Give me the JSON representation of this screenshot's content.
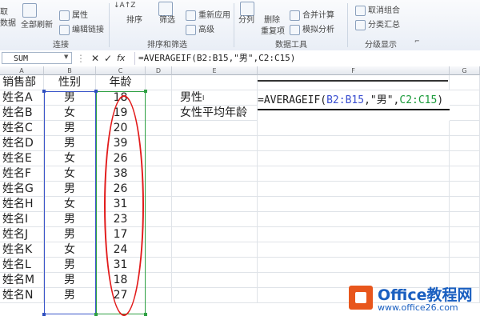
{
  "ribbon": {
    "groups": {
      "connections": "连接",
      "sort_filter": "排序和筛选",
      "data_tools": "数据工具",
      "outline": "分级显示"
    },
    "buttons": {
      "get_data_1": "取",
      "get_data_2": "数据",
      "refresh_all": "全部刷新",
      "properties": "属性",
      "edit_links": "编辑链接",
      "sort": "排序",
      "filter": "筛选",
      "reapply": "重新应用",
      "advanced": "高级",
      "text_to_columns": "分列",
      "remove_dup_1": "删除",
      "remove_dup_2": "重复项",
      "consolidate": "合并计算",
      "what_if": "模拟分析",
      "ungroup": "取消组合",
      "subtotal": "分类汇总"
    }
  },
  "formula_bar": {
    "name_box": "SUM",
    "cancel_glyph": "✕",
    "enter_glyph": "✓",
    "fx_glyph": "fx",
    "formula": "=AVERAGEIF(B2:B15,\"男\",C2:C15)"
  },
  "columns": [
    "A",
    "B",
    "C",
    "D",
    "E",
    "F",
    "G"
  ],
  "headers": {
    "a": "销售部",
    "b": "性别",
    "c": "年龄"
  },
  "rows": [
    {
      "name": "姓名A",
      "gender": "男",
      "age": "18"
    },
    {
      "name": "姓名B",
      "gender": "女",
      "age": "19"
    },
    {
      "name": "姓名C",
      "gender": "男",
      "age": "20"
    },
    {
      "name": "姓名D",
      "gender": "男",
      "age": "39"
    },
    {
      "name": "姓名E",
      "gender": "女",
      "age": "26"
    },
    {
      "name": "姓名F",
      "gender": "女",
      "age": "38"
    },
    {
      "name": "姓名G",
      "gender": "男",
      "age": "26"
    },
    {
      "name": "姓名H",
      "gender": "女",
      "age": "31"
    },
    {
      "name": "姓名I",
      "gender": "男",
      "age": "23"
    },
    {
      "name": "姓名J",
      "gender": "男",
      "age": "17"
    },
    {
      "name": "姓名K",
      "gender": "女",
      "age": "24"
    },
    {
      "name": "姓名L",
      "gender": "男",
      "age": "31"
    },
    {
      "name": "姓名M",
      "gender": "男",
      "age": "18"
    },
    {
      "name": "姓名N",
      "gender": "男",
      "age": "27"
    }
  ],
  "labels": {
    "male": "男性",
    "female_avg": "女性平均年龄"
  },
  "editing_formula": {
    "prefix": "=AVERAGEIF(",
    "range1": "B2:B15",
    "mid": ",\"男\",",
    "range2": "C2:C15",
    "suffix": ")"
  },
  "watermark": {
    "title": "Office教程网",
    "url": "www.office26.com"
  },
  "colors": {
    "range1": "#3b4fd0",
    "range2": "#1a9a3a",
    "oval": "#e21b1b",
    "brand": "#1a5fc0"
  }
}
